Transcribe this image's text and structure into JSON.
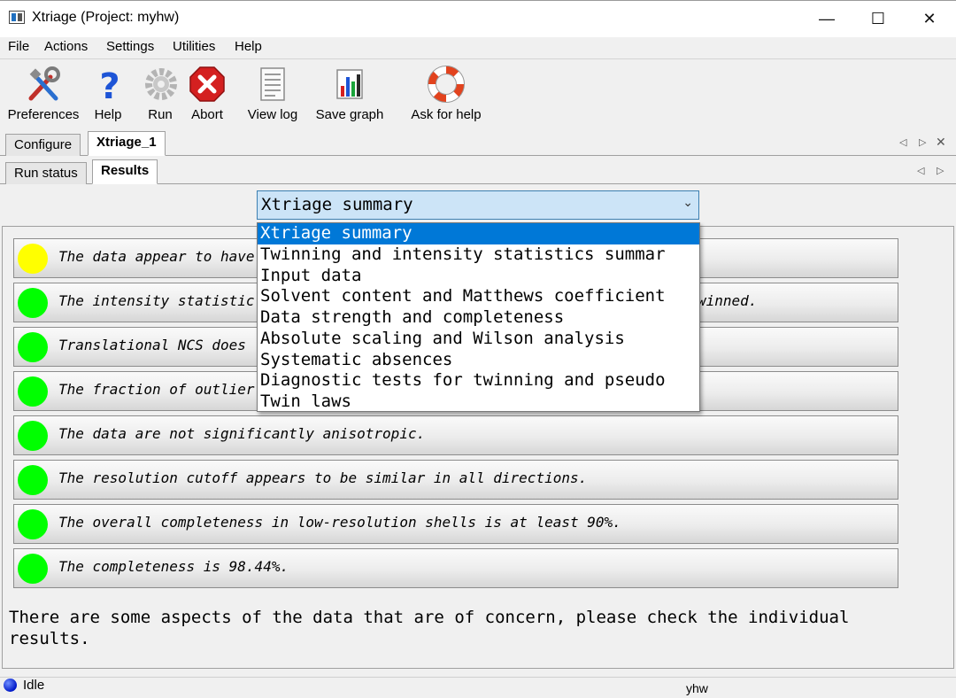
{
  "window": {
    "title": "Xtriage (Project: myhw)",
    "controls": {
      "minimize": "—",
      "maximize": "☐",
      "close": "✕"
    }
  },
  "menu": [
    "File",
    "Actions",
    "Settings",
    "Utilities",
    "Help"
  ],
  "toolbar": [
    {
      "label": "Preferences",
      "icon": "preferences-tools-icon"
    },
    {
      "label": "Help",
      "icon": "help-question-icon"
    },
    {
      "label": "Run",
      "icon": "run-gear-icon"
    },
    {
      "label": "Abort",
      "icon": "abort-stop-icon"
    },
    {
      "label": "View log",
      "icon": "view-log-icon"
    },
    {
      "label": "Save graph",
      "icon": "save-graph-icon"
    },
    {
      "label": "Ask for help",
      "icon": "ask-help-lifebuoy-icon"
    }
  ],
  "outer_tabs": {
    "items": [
      "Configure",
      "Xtriage_1"
    ],
    "active": "Xtriage_1"
  },
  "inner_tabs": {
    "items": [
      "Run status",
      "Results"
    ],
    "active": "Results"
  },
  "section_select": {
    "value": "Xtriage summary",
    "options": [
      "Xtriage summary",
      "Twinning and intensity statistics summar",
      "Input data",
      "Solvent content and Matthews coefficient",
      "Data strength and completeness",
      "Absolute scaling and Wilson analysis",
      "Systematic absences",
      "Diagnostic tests for twinning and pseudo",
      "Twin laws"
    ],
    "selected_index": 0
  },
  "results": [
    {
      "status": "yellow",
      "text": "The data appear to have",
      "tail": ""
    },
    {
      "status": "green",
      "text": "The intensity statistic",
      "tail": "winned."
    },
    {
      "status": "green",
      "text": "Translational NCS does",
      "tail": ""
    },
    {
      "status": "green",
      "text": "The fraction of outlier",
      "tail": ""
    },
    {
      "status": "green",
      "text": "The data are not significantly anisotropic.",
      "tail": ""
    },
    {
      "status": "green",
      "text": "The resolution cutoff appears to be similar in all directions.",
      "tail": ""
    },
    {
      "status": "green",
      "text": "The overall completeness in low-resolution shells is at least 90%.",
      "tail": ""
    },
    {
      "status": "green",
      "text": "The completeness is 98.44%.",
      "tail": ""
    }
  ],
  "summary": "There are some aspects of the data that are of concern, please check the individual results.",
  "status_colors": {
    "green": "#00ff00",
    "yellow": "#ffff00"
  },
  "statusbar": {
    "state": "Idle",
    "project": "yhw"
  }
}
